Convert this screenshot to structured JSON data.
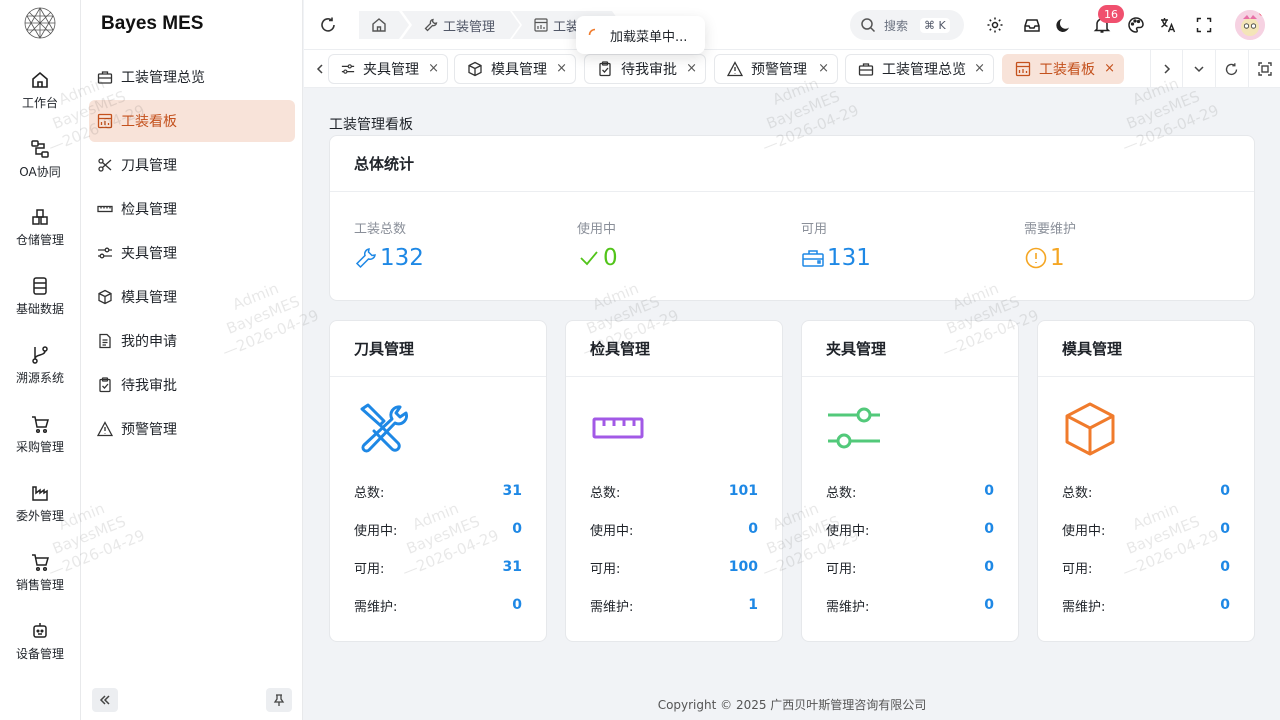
{
  "rail": {
    "items": [
      {
        "label": "工作台",
        "icon": "home-icon"
      },
      {
        "label": "OA协同",
        "icon": "workflow-icon"
      },
      {
        "label": "仓储管理",
        "icon": "warehouse-icon"
      },
      {
        "label": "基础数据",
        "icon": "database-icon"
      },
      {
        "label": "溯源系统",
        "icon": "branch-icon"
      },
      {
        "label": "采购管理",
        "icon": "cart-icon"
      },
      {
        "label": "委外管理",
        "icon": "factory-icon"
      },
      {
        "label": "销售管理",
        "icon": "shopping-cart-icon"
      },
      {
        "label": "设备管理",
        "icon": "robot-icon"
      }
    ]
  },
  "sidebar": {
    "brand": "Bayes MES",
    "items": [
      {
        "label": "工装管理总览",
        "icon": "toolbox-icon"
      },
      {
        "label": "工装看板",
        "icon": "dashboard-icon",
        "active": true
      },
      {
        "label": "刀具管理",
        "icon": "scissors-icon"
      },
      {
        "label": "检具管理",
        "icon": "ruler-icon"
      },
      {
        "label": "夹具管理",
        "icon": "sliders-icon"
      },
      {
        "label": "模具管理",
        "icon": "box-icon"
      },
      {
        "label": "我的申请",
        "icon": "document-icon"
      },
      {
        "label": "待我审批",
        "icon": "clipboard-check-icon"
      },
      {
        "label": "预警管理",
        "icon": "warning-icon"
      }
    ]
  },
  "header": {
    "breadcrumbs": [
      {
        "label": "",
        "icon": "home-icon"
      },
      {
        "label": "工装管理",
        "icon": "wrench-icon"
      },
      {
        "label": "工装",
        "icon": "dashboard-icon"
      }
    ],
    "search_placeholder": "搜索",
    "search_shortcut": "⌘ K",
    "notification_count": "16"
  },
  "toast": {
    "text": "加载菜单中..."
  },
  "tabs": [
    {
      "label": "夹具管理",
      "icon": "sliders-icon"
    },
    {
      "label": "模具管理",
      "icon": "box-icon"
    },
    {
      "label": "待我审批",
      "icon": "clipboard-check-icon"
    },
    {
      "label": "预警管理",
      "icon": "warning-icon"
    },
    {
      "label": "工装管理总览",
      "icon": "toolbox-icon"
    },
    {
      "label": "工装看板",
      "icon": "dashboard-icon",
      "active": true
    }
  ],
  "tab_close": "×",
  "main": {
    "title": "工装管理看板",
    "overview": {
      "title": "总体统计",
      "stats": [
        {
          "label": "工装总数",
          "value": "132",
          "color": "#1e88e5",
          "icon": "wrench-icon"
        },
        {
          "label": "使用中",
          "value": "0",
          "color": "#52c41a",
          "icon": "check-icon"
        },
        {
          "label": "可用",
          "value": "131",
          "color": "#1e88e5",
          "icon": "toolbox-icon"
        },
        {
          "label": "需要维护",
          "value": "1",
          "color": "#f5a623",
          "icon": "alert-circle-icon"
        }
      ]
    },
    "categories": [
      {
        "title": "刀具管理",
        "icon": "tools-icon",
        "color": "#1e88e5",
        "rows": [
          {
            "k": "总数:",
            "v": "31"
          },
          {
            "k": "使用中:",
            "v": "0"
          },
          {
            "k": "可用:",
            "v": "31"
          },
          {
            "k": "需维护:",
            "v": "0"
          }
        ]
      },
      {
        "title": "检具管理",
        "icon": "ruler-icon",
        "color": "#a259e6",
        "rows": [
          {
            "k": "总数:",
            "v": "101"
          },
          {
            "k": "使用中:",
            "v": "0"
          },
          {
            "k": "可用:",
            "v": "100"
          },
          {
            "k": "需维护:",
            "v": "1"
          }
        ]
      },
      {
        "title": "夹具管理",
        "icon": "sliders-icon",
        "color": "#52c97a",
        "rows": [
          {
            "k": "总数:",
            "v": "0"
          },
          {
            "k": "使用中:",
            "v": "0"
          },
          {
            "k": "可用:",
            "v": "0"
          },
          {
            "k": "需维护:",
            "v": "0"
          }
        ]
      },
      {
        "title": "模具管理",
        "icon": "box-icon",
        "color": "#f07b2c",
        "rows": [
          {
            "k": "总数:",
            "v": "0"
          },
          {
            "k": "使用中:",
            "v": "0"
          },
          {
            "k": "可用:",
            "v": "0"
          },
          {
            "k": "需维护:",
            "v": "0"
          }
        ]
      }
    ]
  },
  "footer": {
    "text": "Copyright © 2025 广西贝叶斯管理咨询有限公司"
  },
  "watermark": {
    "user": "Admin",
    "brand": "BayesMES",
    "date": "2026-04-29"
  }
}
